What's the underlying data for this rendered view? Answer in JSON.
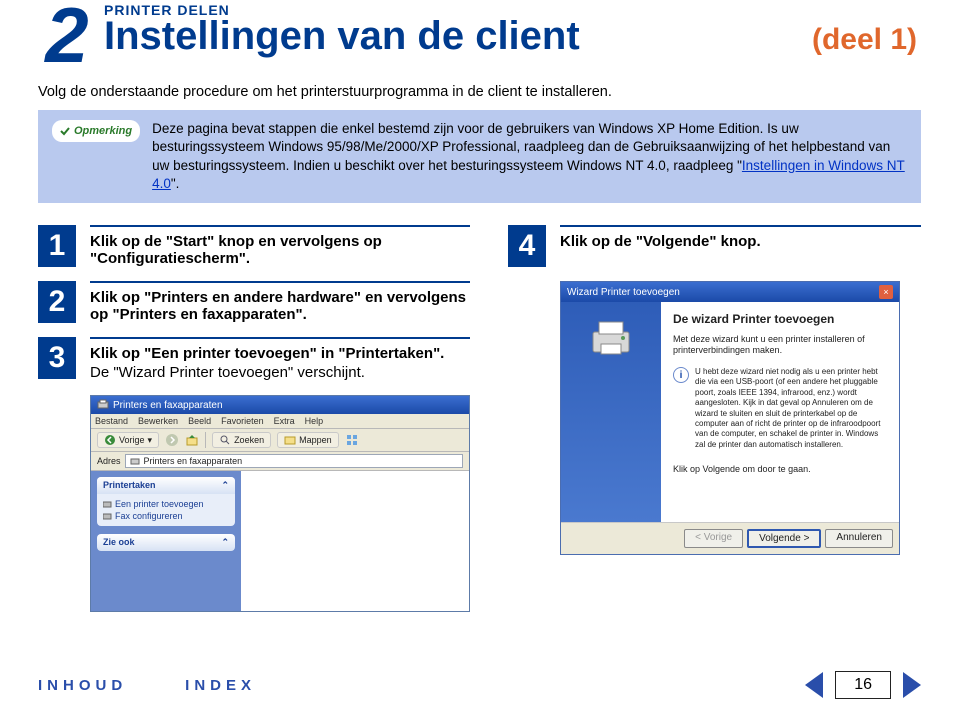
{
  "header": {
    "chapter_number": "2",
    "section_label": "PRINTER DELEN",
    "title": "Instellingen van de client",
    "part": "(deel 1)"
  },
  "intro": "Volg de onderstaande procedure om het printerstuurprogramma in de client te installeren.",
  "note": {
    "badge": "Opmerking",
    "text_before_link": "Deze pagina bevat stappen die enkel bestemd zijn voor de gebruikers van Windows XP Home Edition. Is uw besturingssysteem Windows 95/98/Me/2000/XP Professional, raadpleeg dan de Gebruiksaanwijzing of het helpbestand van uw besturingssysteem. Indien u beschikt over het besturingssysteem Windows NT 4.0, raadpleeg \"",
    "link": "Instellingen in Windows NT 4.0",
    "text_after_link": "\"."
  },
  "steps": {
    "s1": {
      "num": "1",
      "text": "Klik op de \"Start\" knop en vervolgens op \"Configuratiescherm\"."
    },
    "s2": {
      "num": "2",
      "text": "Klik op \"Printers en andere hardware\" en vervolgens op \"Printers en faxapparaten\"."
    },
    "s3": {
      "num": "3",
      "text": "Klik op \"Een printer toevoegen\" in \"Printertaken\".",
      "sub": "De \"Wizard Printer toevoegen\" verschijnt."
    },
    "s4": {
      "num": "4",
      "text": "Klik op de \"Volgende\" knop."
    }
  },
  "xp": {
    "title": "Printers en faxapparaten",
    "menu": [
      "Bestand",
      "Bewerken",
      "Beeld",
      "Favorieten",
      "Extra",
      "Help"
    ],
    "toolbar": {
      "back": "Vorige",
      "search": "Zoeken",
      "folders": "Mappen"
    },
    "addr_label": "Adres",
    "addr_value": "Printers en faxapparaten",
    "tasks_title": "Printertaken",
    "tasks": [
      "Een printer toevoegen",
      "Fax configureren"
    ],
    "seealso_title": "Zie ook"
  },
  "wizard": {
    "title": "Wizard Printer toevoegen",
    "heading": "De wizard Printer toevoegen",
    "desc": "Met deze wizard kunt u een printer installeren of printerverbindingen maken.",
    "info": "U hebt deze wizard niet nodig als u een printer hebt die via een USB-poort (of een andere het pluggable poort, zoals IEEE 1394, infrarood, enz.) wordt aangesloten. Kijk in dat geval op Annuleren om de wizard te sluiten en sluit de printerkabel op de computer aan of richt de printer op de infraroodpoort van de computer, en schakel de printer in. Windows zal de printer dan automatisch installeren.",
    "cont": "Klik op Volgende om door te gaan.",
    "buttons": {
      "back": "< Vorige",
      "next": "Volgende >",
      "cancel": "Annuleren"
    }
  },
  "footer": {
    "toc": "INHOUD",
    "index": "INDEX",
    "page": "16"
  }
}
